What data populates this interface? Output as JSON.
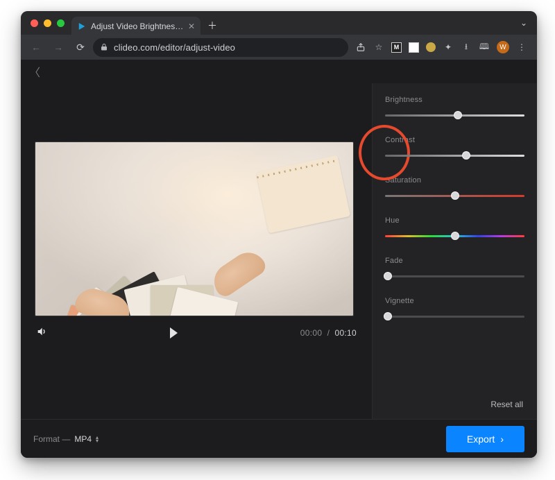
{
  "chrome": {
    "tab_title": "Adjust Video Brightness, Cont",
    "url": "clideo.com/editor/adjust-video",
    "avatar_letter": "W"
  },
  "player": {
    "time_current": "00:00",
    "time_total": "00:10"
  },
  "adjust": {
    "brightness": {
      "label": "Brightness",
      "value": 52
    },
    "contrast": {
      "label": "Contrast",
      "value": 58
    },
    "saturation": {
      "label": "Saturation",
      "value": 50
    },
    "hue": {
      "label": "Hue",
      "value": 50
    },
    "fade": {
      "label": "Fade",
      "value": 2
    },
    "vignette": {
      "label": "Vignette",
      "value": 2
    },
    "reset_label": "Reset all"
  },
  "footer": {
    "format_prefix": "Format  —",
    "format_value": "MP4",
    "export_label": "Export"
  }
}
